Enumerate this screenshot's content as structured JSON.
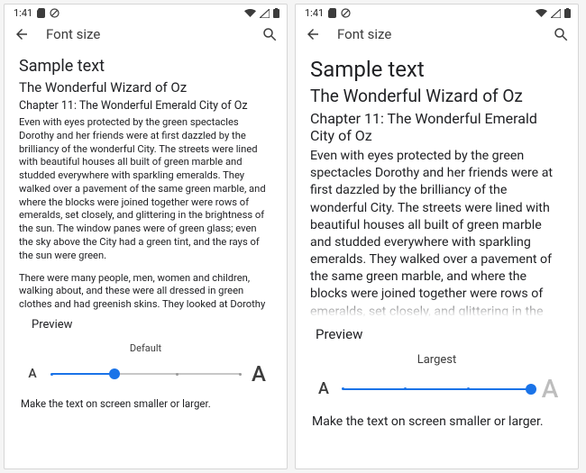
{
  "status_time": "1:41",
  "appbar_title": "Font size",
  "sample_heading": "Sample text",
  "book_title": "The Wonderful Wizard of Oz",
  "chapter": "Chapter 11: The Wonderful Emerald City of Oz",
  "para1": "Even with eyes protected by the green spectacles Dorothy and her friends were at first dazzled by the brilliancy of the wonderful City. The streets were lined with beautiful houses all built of green marble and studded everywhere with sparkling emeralds. They walked over a pavement of the same green marble, and where the blocks were joined together were rows of emeralds, set closely, and glittering in the brightness of the sun. The window panes were of green glass; even the sky above the City had a green tint, and the rays of the sun were green.",
  "para2": "There were many people, men, women and children, walking about, and these were all dressed in green clothes and had greenish skins. They looked at Dorothy and her strangely assorted company with wondering eyes, and the children all ran away and hid behind their mothers when they saw the Lion; but no one spoke to them. Many shops stood in the street, and Dorothy saw that everything in",
  "para1_trunc": "Even with eyes protected by the green spectacles Dorothy and her friends were at first dazzled by the brilliancy of the wonderful City. The streets were lined with beautiful houses all built of green marble and studded everywhere with sparkling emeralds. They walked over a pavement of the same green marble, and where the blocks were joined together were rows of emeralds, set closely, and glittering in the",
  "preview_label": "Preview",
  "slider_label_left": "Default",
  "slider_label_right": "Largest",
  "glyph_A": "A",
  "desc": "Make the text on screen smaller or larger.",
  "slider": {
    "steps": 4,
    "left_value": 1,
    "right_value": 3
  },
  "colors": {
    "accent": "#1a73e8",
    "muted": "#bdbdbd"
  }
}
